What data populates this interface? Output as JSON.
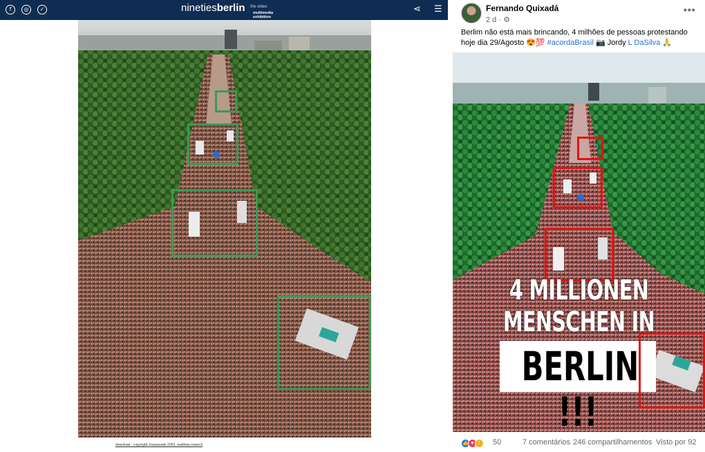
{
  "left_page": {
    "logo_part1": "nineties",
    "logo_part2": "berlin",
    "logo_tag": "the video",
    "logo_sub1": "multimedia",
    "logo_sub2": "exhibition",
    "social_icons": [
      "facebook-icon",
      "instagram-icon",
      "twitter-icon"
    ],
    "caption": "download · copyright: loveparade 2003, matthias rowieck"
  },
  "post": {
    "author": "Fernando Quixadá",
    "time": "2 d ·",
    "text_main": "Berlim não está mais brincando, 4 milhões de pessoas protestando hoje dia 29/Agosto 😍💯 ",
    "hashtag": "#acordaBrasil",
    "text_photo": " 📷 Jordy ",
    "photographer_link": "L DaSilva",
    "text_end": " 🙏",
    "image_line1": "4 MILLIONEN",
    "image_line2": "MENSCHEN IN",
    "image_line3": "BERLIN !!!",
    "reactions_count": "50",
    "comments": "7 comentários",
    "shares": "246 compartilhamentos",
    "views": "Visto por 92"
  },
  "colors": {
    "header_bg": "#0f2d52",
    "green_box": "#3a9a55",
    "red_box": "#e01313",
    "link_blue": "#216fdb"
  }
}
